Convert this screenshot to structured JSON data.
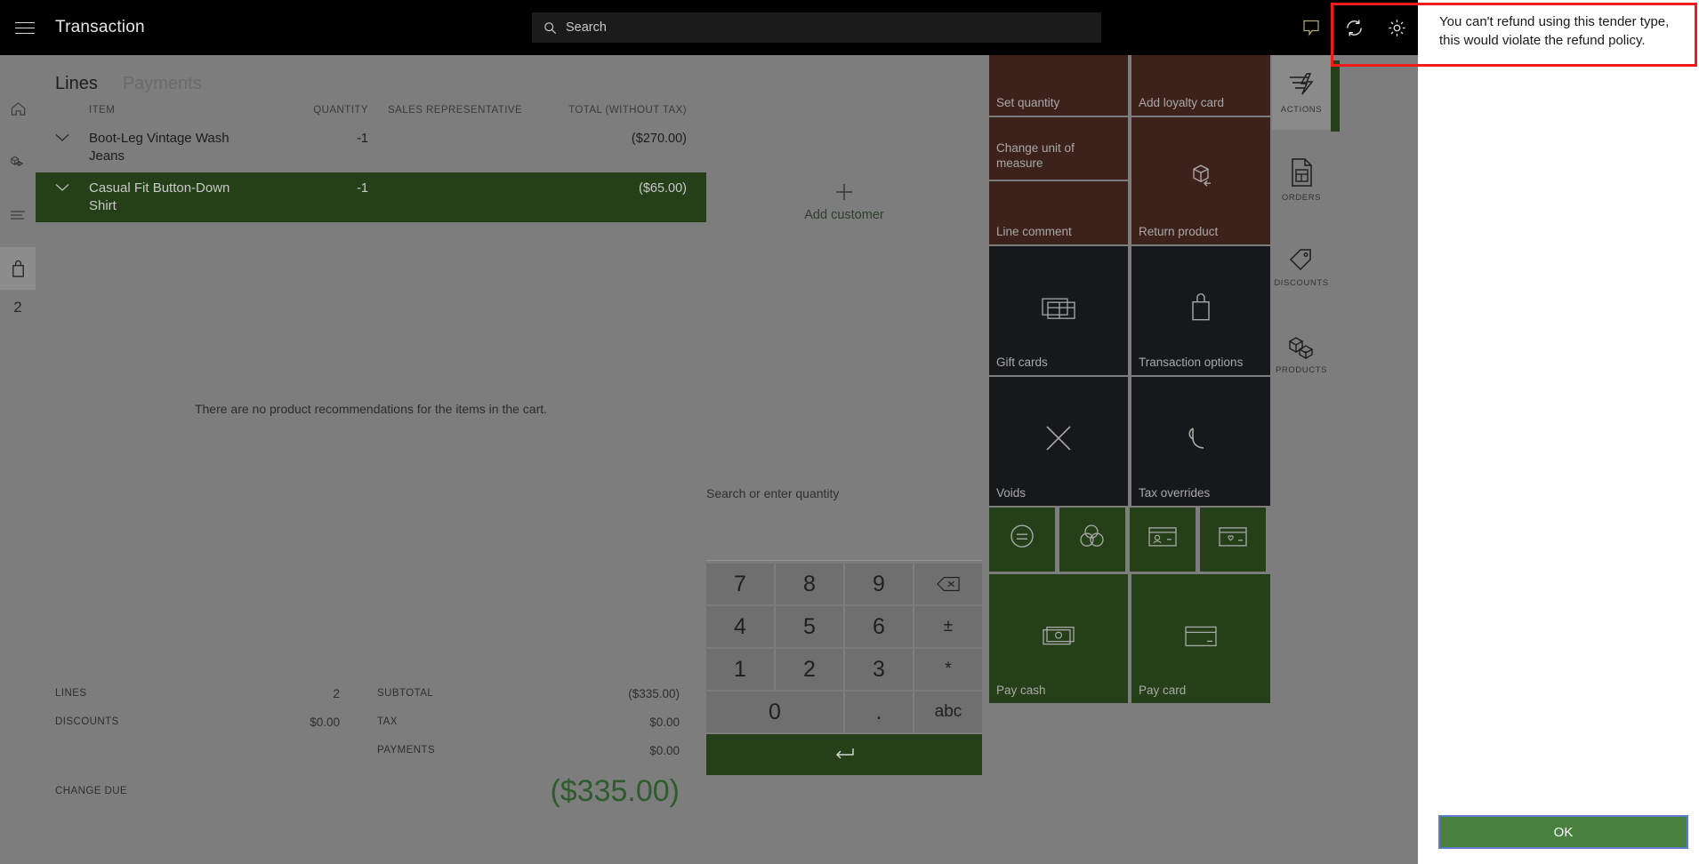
{
  "topbar": {
    "title": "Transaction",
    "menu_icon": "hamburger-icon",
    "search_placeholder": "Search",
    "icons": [
      "speech-bubble-icon",
      "refresh-icon",
      "gear-icon"
    ]
  },
  "left_rail": {
    "items": [
      {
        "name": "home",
        "icon": "home-icon"
      },
      {
        "name": "products",
        "icon": "cubes-icon"
      },
      {
        "name": "lines",
        "icon": "list-icon"
      },
      {
        "name": "cart",
        "icon": "shopping-bag-icon",
        "selected": true
      }
    ],
    "badge_count": "2"
  },
  "cart": {
    "tabs": [
      {
        "label": "Lines",
        "active": true
      },
      {
        "label": "Payments",
        "active": false
      }
    ],
    "columns": {
      "item": "ITEM",
      "quantity": "QUANTITY",
      "sales_rep": "SALES REPRESENTATIVE",
      "total": "TOTAL (WITHOUT TAX)"
    },
    "rows": [
      {
        "item": "Boot-Leg Vintage Wash Jeans",
        "quantity": "-1",
        "sales_rep": "",
        "total": "($270.00)",
        "selected": false
      },
      {
        "item": "Casual Fit Button-Down Shirt",
        "quantity": "-1",
        "sales_rep": "",
        "total": "($65.00)",
        "selected": true
      }
    ],
    "recommendations_text": "There are no product recommendations for the items in the cart.",
    "totals_left": [
      {
        "label": "LINES",
        "value": "2"
      },
      {
        "label": "DISCOUNTS",
        "value": "$0.00"
      }
    ],
    "totals_right": [
      {
        "label": "SUBTOTAL",
        "value": "($335.00)"
      },
      {
        "label": "TAX",
        "value": "$0.00"
      },
      {
        "label": "PAYMENTS",
        "value": "$0.00"
      }
    ],
    "change_due": {
      "label": "CHANGE DUE",
      "value": "($335.00)"
    }
  },
  "customer": {
    "add_label": "Add customer",
    "add_icon": "plus-icon"
  },
  "numpad": {
    "field_placeholder": "Search or enter quantity",
    "keys": [
      {
        "label": "7",
        "name": "key-7"
      },
      {
        "label": "8",
        "name": "key-8"
      },
      {
        "label": "9",
        "name": "key-9"
      },
      {
        "label": "",
        "name": "key-backspace",
        "icon": "backspace-icon"
      },
      {
        "label": "4",
        "name": "key-4"
      },
      {
        "label": "5",
        "name": "key-5"
      },
      {
        "label": "6",
        "name": "key-6"
      },
      {
        "label": "±",
        "name": "key-plus-minus"
      },
      {
        "label": "1",
        "name": "key-1"
      },
      {
        "label": "2",
        "name": "key-2"
      },
      {
        "label": "3",
        "name": "key-3"
      },
      {
        "label": "*",
        "name": "key-asterisk"
      },
      {
        "label": "0",
        "name": "key-0"
      },
      {
        "label": ".",
        "name": "key-decimal"
      },
      {
        "label": "abc",
        "name": "key-abc"
      }
    ],
    "enter_label": "",
    "enter_icon": "enter-arrow-icon"
  },
  "tiles": [
    {
      "label": "Set quantity",
      "style": "brown",
      "icon": ""
    },
    {
      "label": "Add loyalty card",
      "style": "brown",
      "icon": ""
    },
    {
      "label": "Change unit of measure",
      "style": "brown",
      "icon": ""
    },
    {
      "label": "Return product",
      "style": "brown",
      "icon": "return-box-icon"
    },
    {
      "label": "Line comment",
      "style": "brown",
      "icon": ""
    },
    {
      "label": "Gift cards",
      "style": "dark",
      "icon": "gift-card-icon"
    },
    {
      "label": "Transaction options",
      "style": "dark",
      "icon": "shopping-bag-icon"
    },
    {
      "label": "Voids",
      "style": "dark",
      "icon": "close-x-icon"
    },
    {
      "label": "Tax overrides",
      "style": "dark",
      "icon": "undo-arrow-icon"
    },
    {
      "label": "",
      "style": "green",
      "icon": "equals-circle-icon"
    },
    {
      "label": "",
      "style": "green",
      "icon": "currency-coins-icon"
    },
    {
      "label": "",
      "style": "green",
      "icon": "id-card-icon"
    },
    {
      "label": "",
      "style": "green",
      "icon": "loyalty-card-icon"
    },
    {
      "label": "Pay cash",
      "style": "green",
      "icon": "cash-icon"
    },
    {
      "label": "Pay card",
      "style": "green",
      "icon": "credit-card-icon"
    }
  ],
  "right_rail": [
    {
      "label": "ACTIONS",
      "icon": "actions-lightning-icon",
      "active": true
    },
    {
      "label": "ORDERS",
      "icon": "orders-document-icon",
      "active": false
    },
    {
      "label": "DISCOUNTS",
      "icon": "discount-tag-icon",
      "active": false
    },
    {
      "label": "PRODUCTS",
      "icon": "products-cubes-icon",
      "active": false
    }
  ],
  "dialog": {
    "message": "You can't refund using this tender type, this would violate the refund policy.",
    "ok_label": "OK"
  },
  "colors": {
    "accent_green": "#254019",
    "ok_button_green": "#49803d",
    "tile_brown": "#3d211b",
    "tile_dark": "#17181c",
    "annotation_red": "#f01c1c",
    "app_chrome_black": "#000000",
    "dim_overlay": "#7d7d7d"
  }
}
